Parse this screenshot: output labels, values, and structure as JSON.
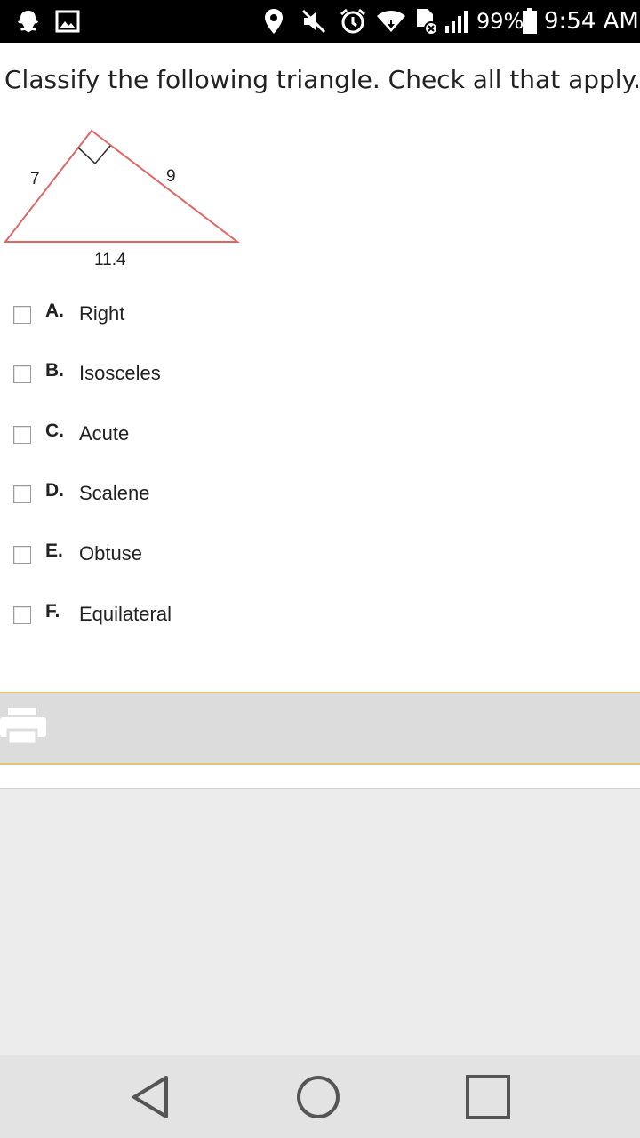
{
  "status_bar": {
    "battery_percent": "99%",
    "time": "9:54 AM",
    "icons": [
      "snapchat-icon",
      "gallery-icon",
      "location-icon",
      "mute-icon",
      "alarm-icon",
      "wifi-icon",
      "sim-icon",
      "signal-icon",
      "battery-icon"
    ]
  },
  "question": {
    "text": "Classify the following triangle. Check all that apply."
  },
  "diagram": {
    "side_left": "7",
    "side_right": "9",
    "side_bottom": "11.4",
    "stroke_color": "#e06666"
  },
  "options": [
    {
      "letter": "A.",
      "text": "Right",
      "checked": false
    },
    {
      "letter": "B.",
      "text": "Isosceles",
      "checked": false
    },
    {
      "letter": "C.",
      "text": "Acute",
      "checked": false
    },
    {
      "letter": "D.",
      "text": "Scalene",
      "checked": false
    },
    {
      "letter": "E.",
      "text": "Obtuse",
      "checked": false
    },
    {
      "letter": "F.",
      "text": "Equilateral",
      "checked": false
    }
  ],
  "toolbar": {
    "icons": [
      "print-icon"
    ],
    "accent_color": "#e3c36d"
  },
  "nav_bar": {
    "icons": [
      "back-icon",
      "home-icon",
      "recents-icon"
    ]
  }
}
